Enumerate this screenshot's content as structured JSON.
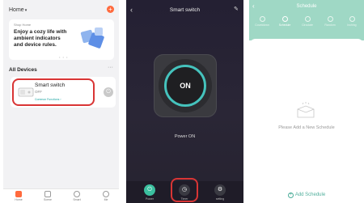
{
  "home": {
    "header_title": "Home",
    "caret": "▾",
    "add_glyph": "+",
    "banner": {
      "small": "Shop Home",
      "line1": "Enjoy a cozy life with",
      "line2": "ambient indicators",
      "line3": "and device rules.",
      "dots": "• • •"
    },
    "section_title": "All Devices",
    "more": "···",
    "device": {
      "name": "Smart switch",
      "state": "OFF",
      "common": "Common Functions ›",
      "power_glyph": "⏻"
    },
    "tabs": [
      {
        "label": "Home",
        "color": "#ff6a3d"
      },
      {
        "label": "Scene",
        "color": "#9a9a9a"
      },
      {
        "label": "Smart",
        "color": "#9a9a9a"
      },
      {
        "label": "Me",
        "color": "#9a9a9a"
      }
    ]
  },
  "switch_screen": {
    "back": "‹",
    "title": "Smart switch",
    "edit": "✎",
    "button_label": "ON",
    "accent": "#45c3bd",
    "status": "Power ON",
    "controls": [
      {
        "label": "Power",
        "glyph": "⏻",
        "color": "#3bbf9f"
      },
      {
        "label": "Timer",
        "glyph": "◷",
        "color": "#3a3a42"
      },
      {
        "label": "setting",
        "glyph": "⚙",
        "color": "#3a3a42"
      }
    ]
  },
  "schedule": {
    "back": "‹",
    "title": "Schedule",
    "tabs": [
      {
        "label": "Countdown"
      },
      {
        "label": "Schedule"
      },
      {
        "label": "Circulate"
      },
      {
        "label": "Random"
      },
      {
        "label": "Inching"
      }
    ],
    "empty_text": "Please Add a New Schedule",
    "add_label": "Add Schedule",
    "add_glyph": "+"
  }
}
